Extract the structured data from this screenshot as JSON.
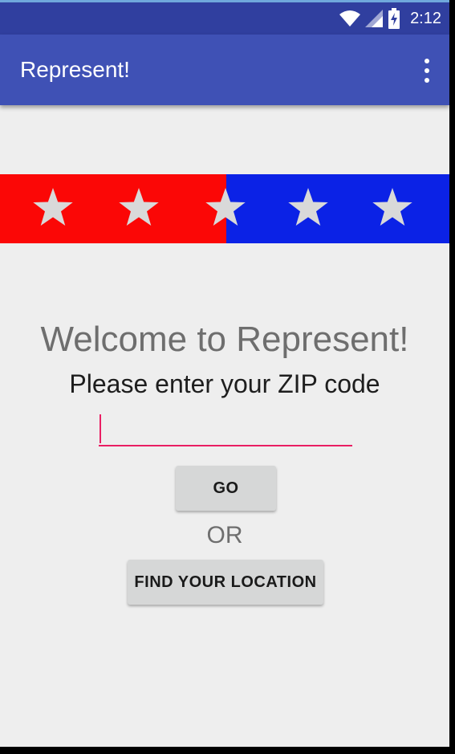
{
  "status_bar": {
    "time": "2:12",
    "icons": [
      "wifi-icon",
      "cell-signal-icon",
      "battery-charging-icon"
    ]
  },
  "app_bar": {
    "title": "Represent!",
    "menu_icon": "overflow-menu-icon"
  },
  "banner": {
    "left_color": "#fb0706",
    "right_color": "#0b22e6",
    "star_color": "#d9d9d9",
    "star_count": 5
  },
  "main": {
    "welcome_text": "Welcome to Represent!",
    "prompt_text": "Please enter your ZIP code",
    "zip_input": {
      "value": "",
      "placeholder": ""
    },
    "go_button_label": "GO",
    "or_text": "OR",
    "find_location_button_label": "FIND YOUR LOCATION"
  },
  "colors": {
    "status_bar": "#303f9f",
    "app_bar": "#3f51b5",
    "accent": "#e91e63",
    "background": "#eeeeee",
    "button": "#d6d7d7"
  }
}
